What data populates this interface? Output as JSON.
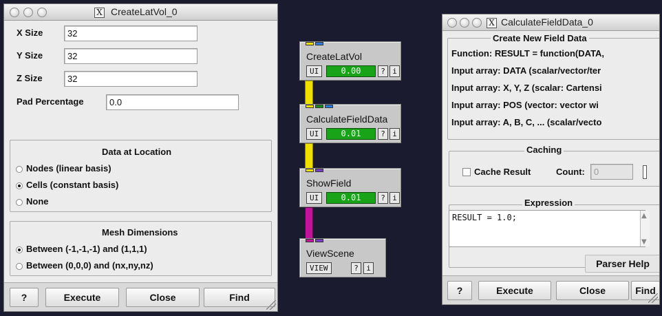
{
  "createlatvol": {
    "title": "CreateLatVol_0",
    "x_label": "X Size",
    "x_value": "32",
    "y_label": "Y Size",
    "y_value": "32",
    "z_label": "Z Size",
    "z_value": "32",
    "pad_label": "Pad Percentage",
    "pad_value": "0.0",
    "data_group": "Data at Location",
    "data_options": [
      "Nodes (linear basis)",
      "Cells (constant basis)",
      "None"
    ],
    "data_selected": 1,
    "mesh_group": "Mesh Dimensions",
    "mesh_options": [
      "Between (-1,-1,-1) and (1,1,1)",
      "Between (0,0,0) and (nx,ny,nz)"
    ],
    "mesh_selected": 0,
    "help_btn": "?",
    "execute_btn": "Execute",
    "close_btn": "Close",
    "find_btn": "Find"
  },
  "network": {
    "modules": [
      {
        "name": "CreateLatVol",
        "ui": "UI",
        "progress": "0.00",
        "q": "?",
        "i": "i"
      },
      {
        "name": "CalculateFieldData",
        "ui": "UI",
        "progress": "0.01",
        "q": "?",
        "i": "i"
      },
      {
        "name": "ShowField",
        "ui": "UI",
        "progress": "0.01",
        "q": "?",
        "i": "i"
      },
      {
        "name": "ViewScene",
        "ui": "VIEW",
        "q": "?",
        "i": "i"
      }
    ]
  },
  "calcfield": {
    "title": "CalculateFieldData_0",
    "new_field_group": "Create New Field Data",
    "lines": [
      "Function: RESULT = function(DATA,",
      "Input array: DATA (scalar/vector/ter",
      "Input array: X, Y, Z (scalar: Cartensi",
      "Input array: POS (vector: vector wi",
      "Input array: A, B, C, ... (scalar/vecto"
    ],
    "caching_group": "Caching",
    "cache_label": "Cache Result",
    "count_label": "Count:",
    "count_value": "0",
    "expression_group": "Expression",
    "expression": "RESULT = 1.0;",
    "parser_help": "Parser Help",
    "help_btn": "?",
    "execute_btn": "Execute",
    "close_btn": "Close",
    "find_btn": "Find"
  },
  "colors": {
    "background": "#1a1b2e",
    "progress_green": "#19a319",
    "pipe_yellow": "#f0e000",
    "pipe_magenta": "#c0149a",
    "port_blue": "#2a7de0",
    "port_green": "#1e8a1e",
    "port_purple": "#7a3fc4"
  }
}
